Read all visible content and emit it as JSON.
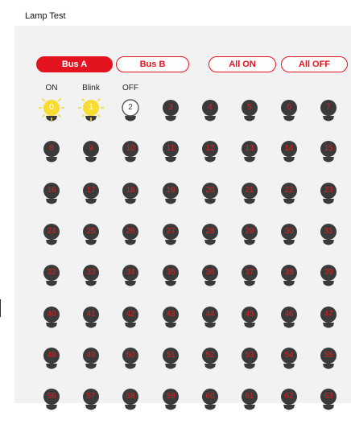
{
  "window": {
    "title": "Lamp Test"
  },
  "buttons": {
    "bus_a": "Bus A",
    "bus_b": "Bus B",
    "all_on": "All ON",
    "all_off": "All OFF"
  },
  "colors": {
    "accent": "#e3141f",
    "lamp_off": "#3a3a3a",
    "lamp_on": "#f7dc32",
    "lamp_number_text": "#e02020"
  },
  "lamps": [
    {
      "label": "0",
      "state": "on",
      "caption": "ON"
    },
    {
      "label": "1",
      "state": "blink",
      "caption": "Blink"
    },
    {
      "label": "2",
      "state": "off",
      "caption": "OFF"
    },
    {
      "label": "3",
      "state": "dark"
    },
    {
      "label": "4",
      "state": "dark"
    },
    {
      "label": "5",
      "state": "dark"
    },
    {
      "label": "6",
      "state": "dark"
    },
    {
      "label": "7",
      "state": "dark"
    },
    {
      "label": "8",
      "state": "dark"
    },
    {
      "label": "9",
      "state": "dark"
    },
    {
      "label": "10",
      "state": "dark"
    },
    {
      "label": "11",
      "state": "dark"
    },
    {
      "label": "12",
      "state": "dark"
    },
    {
      "label": "13",
      "state": "dark"
    },
    {
      "label": "14",
      "state": "dark"
    },
    {
      "label": "15",
      "state": "dark"
    },
    {
      "label": "16",
      "state": "dark"
    },
    {
      "label": "17",
      "state": "dark"
    },
    {
      "label": "18",
      "state": "dark"
    },
    {
      "label": "19",
      "state": "dark"
    },
    {
      "label": "20",
      "state": "dark"
    },
    {
      "label": "21",
      "state": "dark"
    },
    {
      "label": "22",
      "state": "dark"
    },
    {
      "label": "23",
      "state": "dark"
    },
    {
      "label": "24",
      "state": "dark"
    },
    {
      "label": "25",
      "state": "dark"
    },
    {
      "label": "26",
      "state": "dark"
    },
    {
      "label": "27",
      "state": "dark"
    },
    {
      "label": "28",
      "state": "dark"
    },
    {
      "label": "29",
      "state": "dark"
    },
    {
      "label": "30",
      "state": "dark"
    },
    {
      "label": "31",
      "state": "dark"
    },
    {
      "label": "32",
      "state": "dark"
    },
    {
      "label": "33",
      "state": "dark"
    },
    {
      "label": "34",
      "state": "dark"
    },
    {
      "label": "35",
      "state": "dark"
    },
    {
      "label": "36",
      "state": "dark"
    },
    {
      "label": "37",
      "state": "dark"
    },
    {
      "label": "38",
      "state": "dark"
    },
    {
      "label": "39",
      "state": "dark"
    },
    {
      "label": "40",
      "state": "dark"
    },
    {
      "label": "41",
      "state": "dark"
    },
    {
      "label": "42",
      "state": "dark"
    },
    {
      "label": "43",
      "state": "dark"
    },
    {
      "label": "44",
      "state": "dark"
    },
    {
      "label": "45",
      "state": "dark"
    },
    {
      "label": "46",
      "state": "dark"
    },
    {
      "label": "47",
      "state": "dark"
    },
    {
      "label": "48",
      "state": "dark"
    },
    {
      "label": "49",
      "state": "dark"
    },
    {
      "label": "50",
      "state": "dark"
    },
    {
      "label": "51",
      "state": "dark"
    },
    {
      "label": "52",
      "state": "dark"
    },
    {
      "label": "53",
      "state": "dark"
    },
    {
      "label": "54",
      "state": "dark"
    },
    {
      "label": "55",
      "state": "dark"
    },
    {
      "label": "56",
      "state": "dark"
    },
    {
      "label": "57",
      "state": "dark"
    },
    {
      "label": "58",
      "state": "dark"
    },
    {
      "label": "59",
      "state": "dark"
    },
    {
      "label": "60",
      "state": "dark"
    },
    {
      "label": "61",
      "state": "dark"
    },
    {
      "label": "62",
      "state": "dark"
    },
    {
      "label": "63",
      "state": "dark"
    }
  ]
}
